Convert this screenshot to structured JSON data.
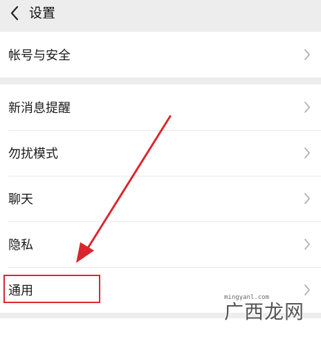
{
  "nav": {
    "title": "设置",
    "back_icon": "chevron-left-icon"
  },
  "groups": [
    {
      "items": [
        {
          "label": "帐号与安全"
        }
      ]
    },
    {
      "items": [
        {
          "label": "新消息提醒"
        },
        {
          "label": "勿扰模式"
        },
        {
          "label": "聊天"
        },
        {
          "label": "隐私"
        },
        {
          "label": "通用"
        }
      ]
    }
  ],
  "annotation": {
    "color": "#d9262d",
    "highlight_target": "通用"
  },
  "watermark": {
    "text": "广西龙网",
    "sub": "mingyanl.com"
  },
  "colors": {
    "background": "#ededed",
    "cell": "#ffffff",
    "text": "#1a1a1a",
    "chevron": "#b2b2b2"
  }
}
